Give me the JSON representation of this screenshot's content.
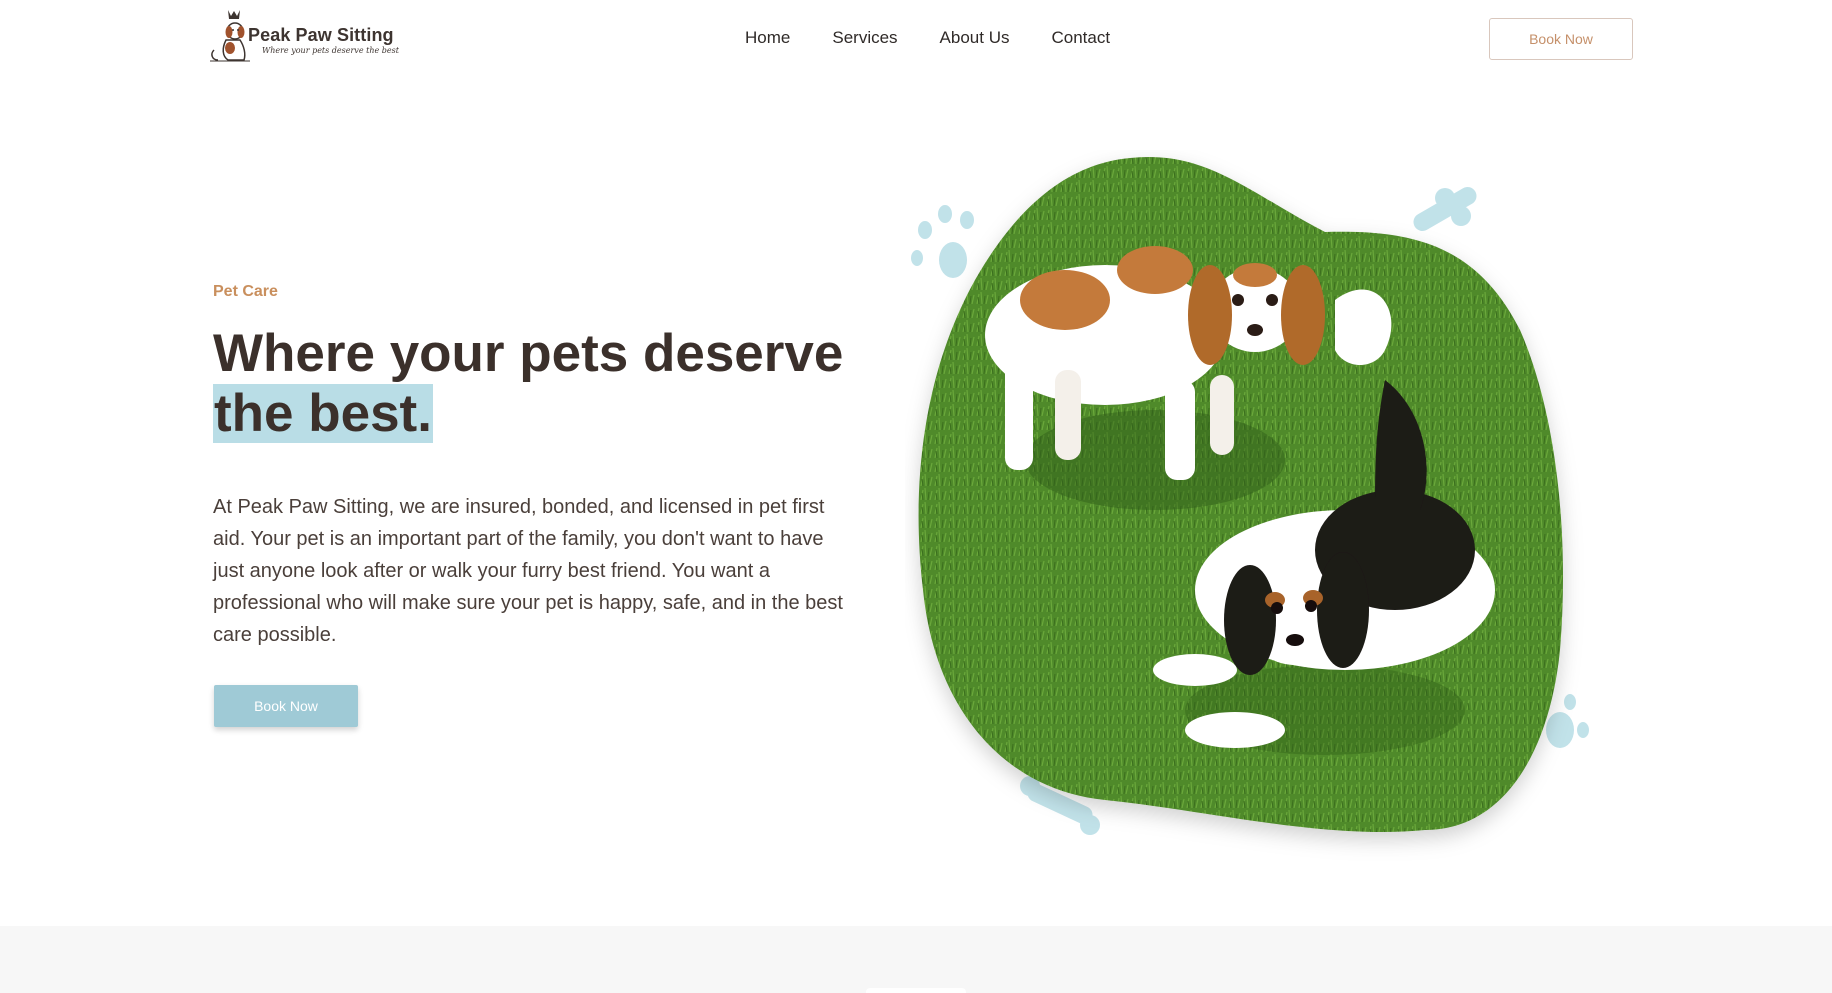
{
  "header": {
    "logo_title": "Peak Paw Sitting",
    "logo_tagline": "Where your pets deserve the best",
    "nav": [
      "Home",
      "Services",
      "About Us",
      "Contact"
    ],
    "book_label": "Book Now"
  },
  "hero": {
    "eyebrow": "Pet Care",
    "headline_main": "Where your pets deserve ",
    "headline_highlight": "the best.",
    "description": "At Peak Paw Sitting, we are insured, bonded, and licensed in pet first aid. Your pet is an important part of the family, you don't want to have just anyone look after or walk your furry best friend. You want a professional who will make sure your pet is happy, safe, and in the best care possible.",
    "cta_label": "Book Now"
  },
  "colors": {
    "accent": "#c98f5d",
    "highlight": "#b9dde6",
    "button": "#9fcad6",
    "text": "#3b302b"
  }
}
